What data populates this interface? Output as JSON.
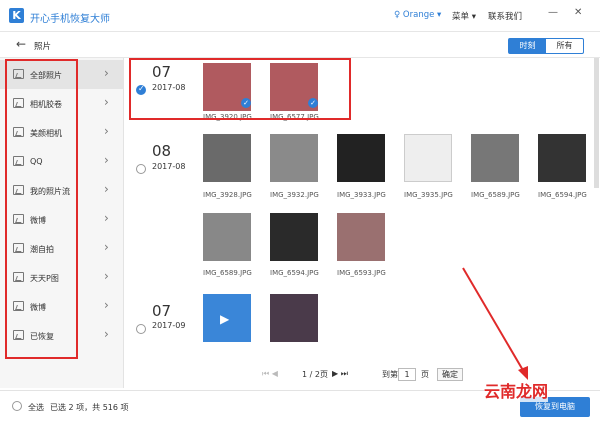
{
  "app": {
    "title": "开心手机恢复大师",
    "logo": "K",
    "user": "♀ Orange ▾",
    "menu": "菜单 ▾",
    "contact": "联系我们",
    "min": "—",
    "close": "✕"
  },
  "nav": {
    "back": "←",
    "crumb": "照片",
    "toggle_time": "时刻",
    "toggle_all": "所有"
  },
  "sidebar": {
    "items": [
      {
        "label": "全部照片"
      },
      {
        "label": "相机胶卷"
      },
      {
        "label": "美颜相机"
      },
      {
        "label": "QQ"
      },
      {
        "label": "我的照片流"
      },
      {
        "label": "微博"
      },
      {
        "label": "潮自拍"
      },
      {
        "label": "天天P图"
      },
      {
        "label": "微博"
      },
      {
        "label": "已恢复"
      }
    ]
  },
  "groups": [
    {
      "day": "07",
      "ym": "2017-08",
      "files": [
        "IMG_3920.JPG",
        "IMG_6577.JPG"
      ]
    },
    {
      "day": "08",
      "ym": "2017-08",
      "files": [
        "IMG_3928.JPG",
        "IMG_3932.JPG",
        "IMG_3933.JPG",
        "IMG_3935.JPG",
        "IMG_6589.JPG",
        "IMG_6594.JPG",
        "IMG_6589.JPG",
        "IMG_6594.JPG",
        "IMG_6593.JPG"
      ]
    },
    {
      "day": "07",
      "ym": "2017-09",
      "files": []
    }
  ],
  "pager": {
    "page": "1 / 2页",
    "goto": "到第",
    "page_value": "1",
    "page_suffix": "页",
    "ok": "确定"
  },
  "bottom": {
    "select_all": "全选",
    "selected": "已选 2 项，共 516 项",
    "restore": "恢复到电脑"
  },
  "watermark": "云南龙网"
}
